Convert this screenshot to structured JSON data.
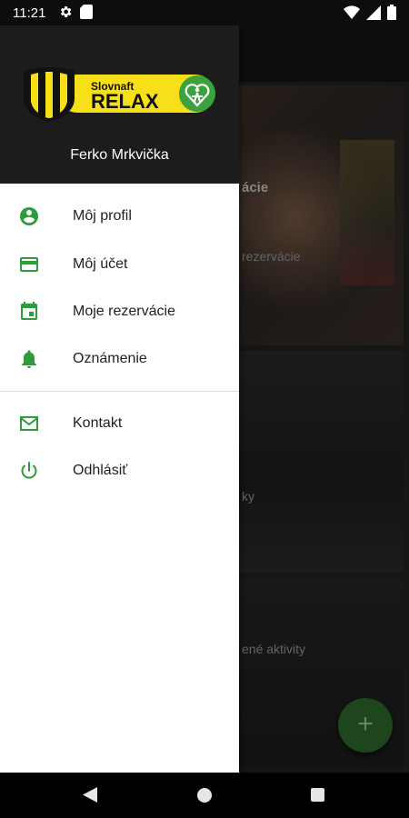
{
  "status_bar": {
    "time": "11:21",
    "icons": [
      "settings-icon",
      "sd-card-icon",
      "wifi-icon",
      "signal-icon",
      "battery-icon"
    ]
  },
  "drawer": {
    "brand": {
      "line1": "Slovnaft",
      "line2": "RELAX"
    },
    "user_name": "Ferko Mrkvička",
    "menu_primary": [
      {
        "label": "Môj profil",
        "icon": "account-circle-icon"
      },
      {
        "label": "Môj účet",
        "icon": "credit-card-icon"
      },
      {
        "label": "Moje rezervácie",
        "icon": "calendar-icon"
      },
      {
        "label": "Oznámenie",
        "icon": "bell-icon"
      }
    ],
    "menu_secondary": [
      {
        "label": "Kontakt",
        "icon": "mail-icon"
      },
      {
        "label": "Odhlásiť",
        "icon": "power-icon"
      }
    ]
  },
  "background": {
    "card1_title": "ácie",
    "card1_sub": "rezervácie",
    "card2_sub": "ky",
    "card3_sub": "ené aktivity"
  },
  "fab_label": "+",
  "colors": {
    "accent": "#2e9c3a",
    "brand_yellow": "#f7e019",
    "drawer_header": "#1c1c1c"
  }
}
